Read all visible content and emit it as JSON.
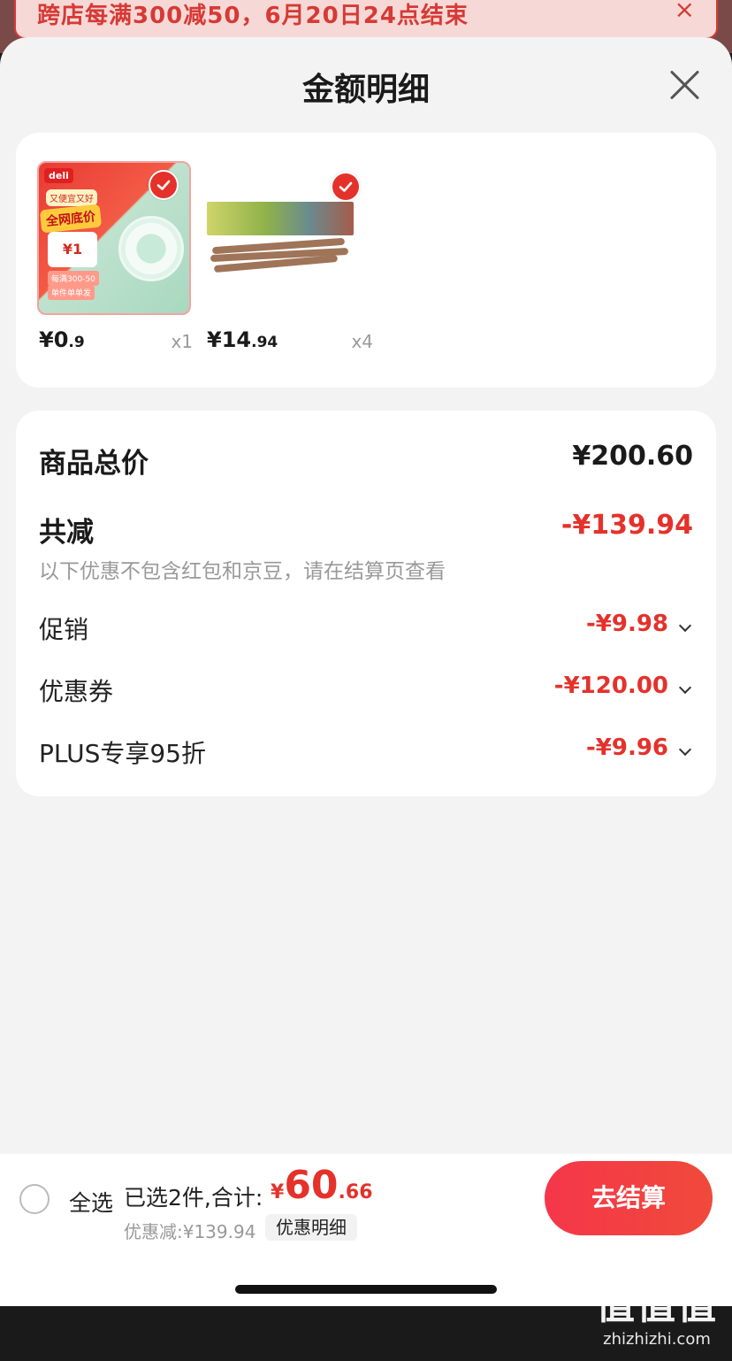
{
  "promo": {
    "text": "跨店每满300减50，6月20日24点结束",
    "close": "×"
  },
  "sheet": {
    "title": "金额明细"
  },
  "products": [
    {
      "thumb_texts": {
        "brand": "deli",
        "tag1": "又便宜又好",
        "tag2": "全网底价",
        "price_tag": "¥1",
        "tag3": "每满300-50",
        "tag4": "单件单单发"
      },
      "price_main": "¥0",
      "price_small": ".9",
      "qty": "x1"
    },
    {
      "price_main": "¥14",
      "price_small": ".94",
      "qty": "x4"
    }
  ],
  "summary": {
    "total_label": "商品总价",
    "total_value": "¥200.60",
    "saving_label": "共减",
    "saving_value": "-¥139.94",
    "note": "以下优惠不包含红包和京豆，请在结算页查看",
    "items": [
      {
        "label": "促销",
        "value": "-¥9.98"
      },
      {
        "label": "优惠券",
        "value": "-¥120.00"
      },
      {
        "label": "PLUS专享95折",
        "value": "-¥9.96"
      }
    ]
  },
  "bottom": {
    "select_all": "全选",
    "selected": "已选2件,合计:",
    "total_yen": "¥",
    "total_big": "60",
    "total_small": ".66",
    "saving": "优惠减:¥139.94",
    "detail": "优惠明细",
    "checkout": "去结算"
  },
  "watermark": {
    "logo": "值值值",
    "url": "zhizhizhi.com"
  },
  "colors": {
    "accent": "#e4322b",
    "checkout": "#f5364a"
  }
}
